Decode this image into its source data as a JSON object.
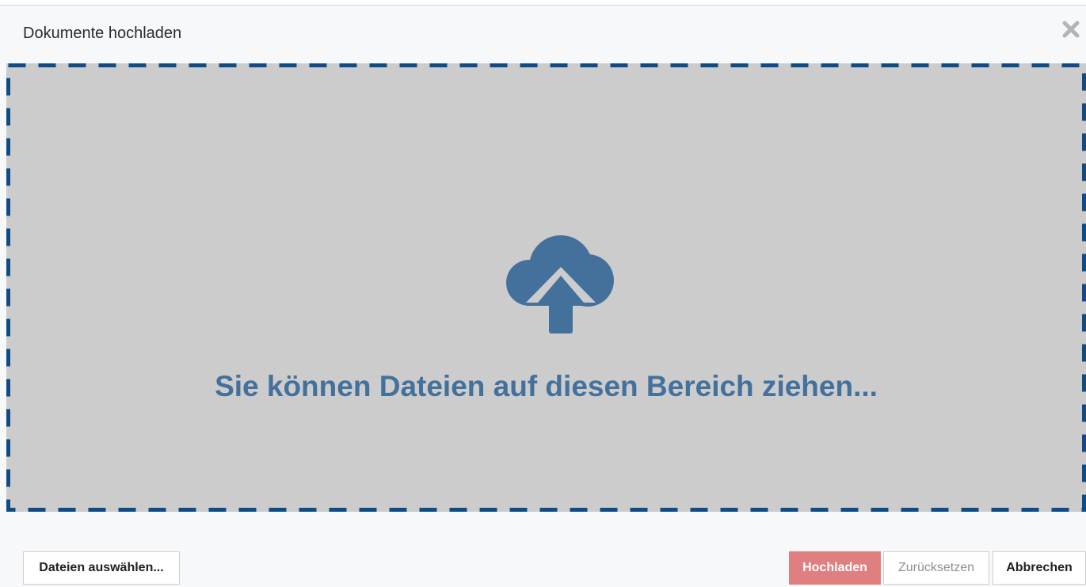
{
  "dialog": {
    "title": "Dokumente hochladen",
    "close_icon": "close-icon"
  },
  "dropzone": {
    "icon": "cloud-upload-icon",
    "text": "Sie können Dateien auf diesen Bereich ziehen...",
    "border_color": "#0f4c86",
    "background_color": "#cccccc",
    "icon_color": "#43719c"
  },
  "footer": {
    "choose_label": "Dateien auswählen...",
    "upload_label": "Hochladen",
    "reset_label": "Zurücksetzen",
    "cancel_label": "Abbrechen",
    "upload_color": "#e07f7f"
  }
}
